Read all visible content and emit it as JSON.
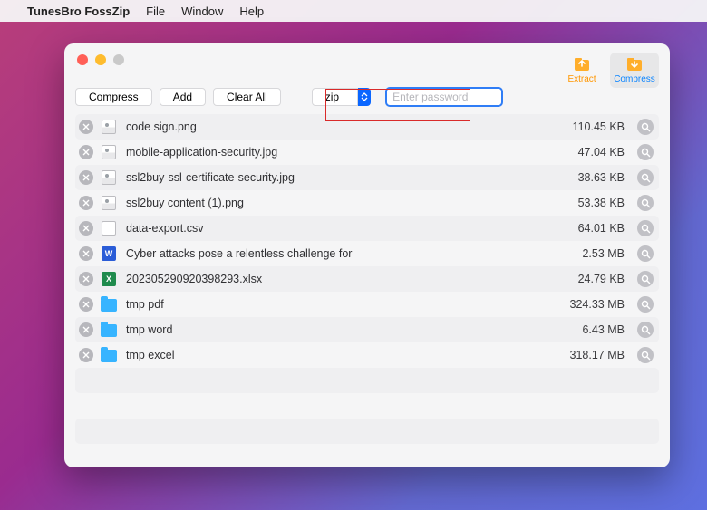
{
  "menubar": {
    "app_title": "TunesBro FossZip",
    "items": [
      "File",
      "Window",
      "Help"
    ]
  },
  "toolbar_top": {
    "extract_label": "Extract",
    "compress_label": "Compress"
  },
  "toolbar2": {
    "compress": "Compress",
    "add": "Add",
    "clear_all": "Clear All",
    "format": "zip",
    "password_placeholder": "Enter password",
    "password_value": ""
  },
  "files": [
    {
      "icon": "img",
      "name": "code sign.png",
      "size": "110.45 KB"
    },
    {
      "icon": "img",
      "name": "mobile-application-security.jpg",
      "size": "47.04 KB"
    },
    {
      "icon": "img",
      "name": "ssl2buy-ssl-certificate-security.jpg",
      "size": "38.63 KB"
    },
    {
      "icon": "img",
      "name": "ssl2buy content (1).png",
      "size": "53.38 KB"
    },
    {
      "icon": "csv",
      "name": "data-export.csv",
      "size": "64.01 KB"
    },
    {
      "icon": "doc",
      "name": "Cyber attacks pose a relentless challenge for",
      "size": "2.53 MB"
    },
    {
      "icon": "xls",
      "name": "202305290920398293.xlsx",
      "size": "24.79 KB"
    },
    {
      "icon": "fld",
      "name": "tmp pdf",
      "size": "324.33 MB"
    },
    {
      "icon": "fld",
      "name": "tmp word",
      "size": "6.43 MB"
    },
    {
      "icon": "fld",
      "name": "tmp excel",
      "size": "318.17 MB"
    }
  ]
}
